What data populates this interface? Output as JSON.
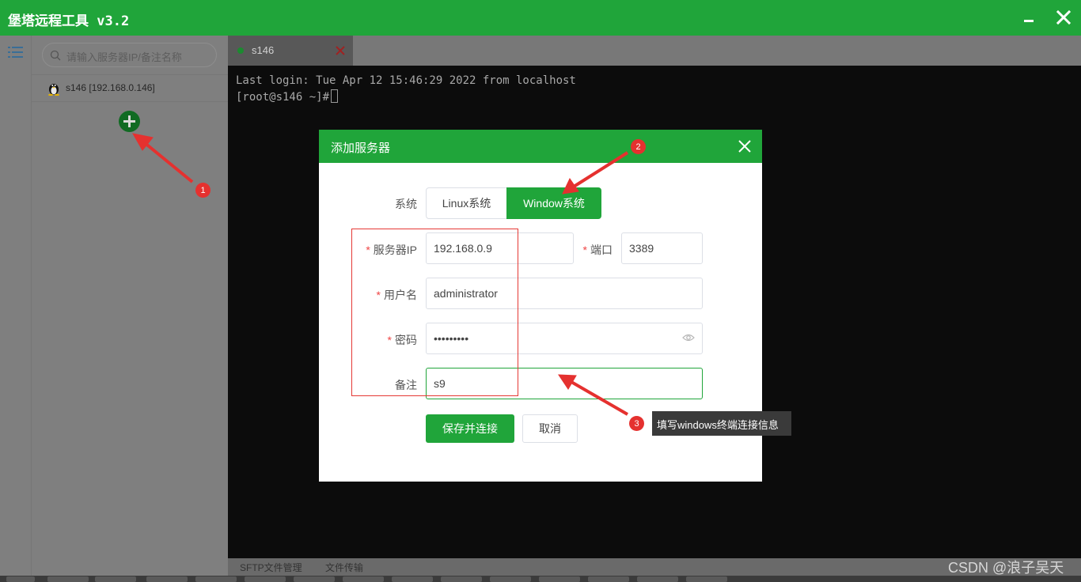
{
  "window": {
    "title": "堡塔远程工具 v3.2",
    "controls": [
      "minimize-icon",
      "close-icon"
    ]
  },
  "sidebar": {
    "search_placeholder": "请输入服务器IP/备注名称",
    "servers": [
      {
        "label": "s146 [192.168.0.146]",
        "os_icon": "linux-tux-icon"
      }
    ]
  },
  "tabs": [
    {
      "label": "s146",
      "status_color": "#1c8a30"
    }
  ],
  "terminal": {
    "lines": [
      "Last login: Tue Apr 12 15:46:29 2022 from localhost",
      "[root@s146 ~]#"
    ]
  },
  "bottom_bar": {
    "items": [
      "SFTP文件管理",
      "文件传输"
    ]
  },
  "modal": {
    "title": "添加服务器",
    "system_label": "系统",
    "system_options": [
      "Linux系统",
      "Window系统"
    ],
    "selected_system": "Window系统",
    "fields": {
      "server_ip": {
        "label": "服务器IP",
        "required": true,
        "value": "192.168.0.9"
      },
      "port": {
        "label": "端口",
        "required": true,
        "value": "3389"
      },
      "username": {
        "label": "用户名",
        "required": true,
        "value": "administrator"
      },
      "password": {
        "label": "密码",
        "required": true,
        "value": "•••••••••"
      },
      "remark": {
        "label": "备注",
        "required": false,
        "value": "s9"
      }
    },
    "save_label": "保存并连接",
    "cancel_label": "取消"
  },
  "annotations": {
    "badges": [
      "1",
      "2",
      "3"
    ],
    "tip": "填写windows终端连接信息",
    "color": "#e5312f"
  },
  "watermark": "CSDN @浪子吴天",
  "colors": {
    "brand_green": "#20a53a",
    "terminal_bg": "#0c0c0c"
  }
}
